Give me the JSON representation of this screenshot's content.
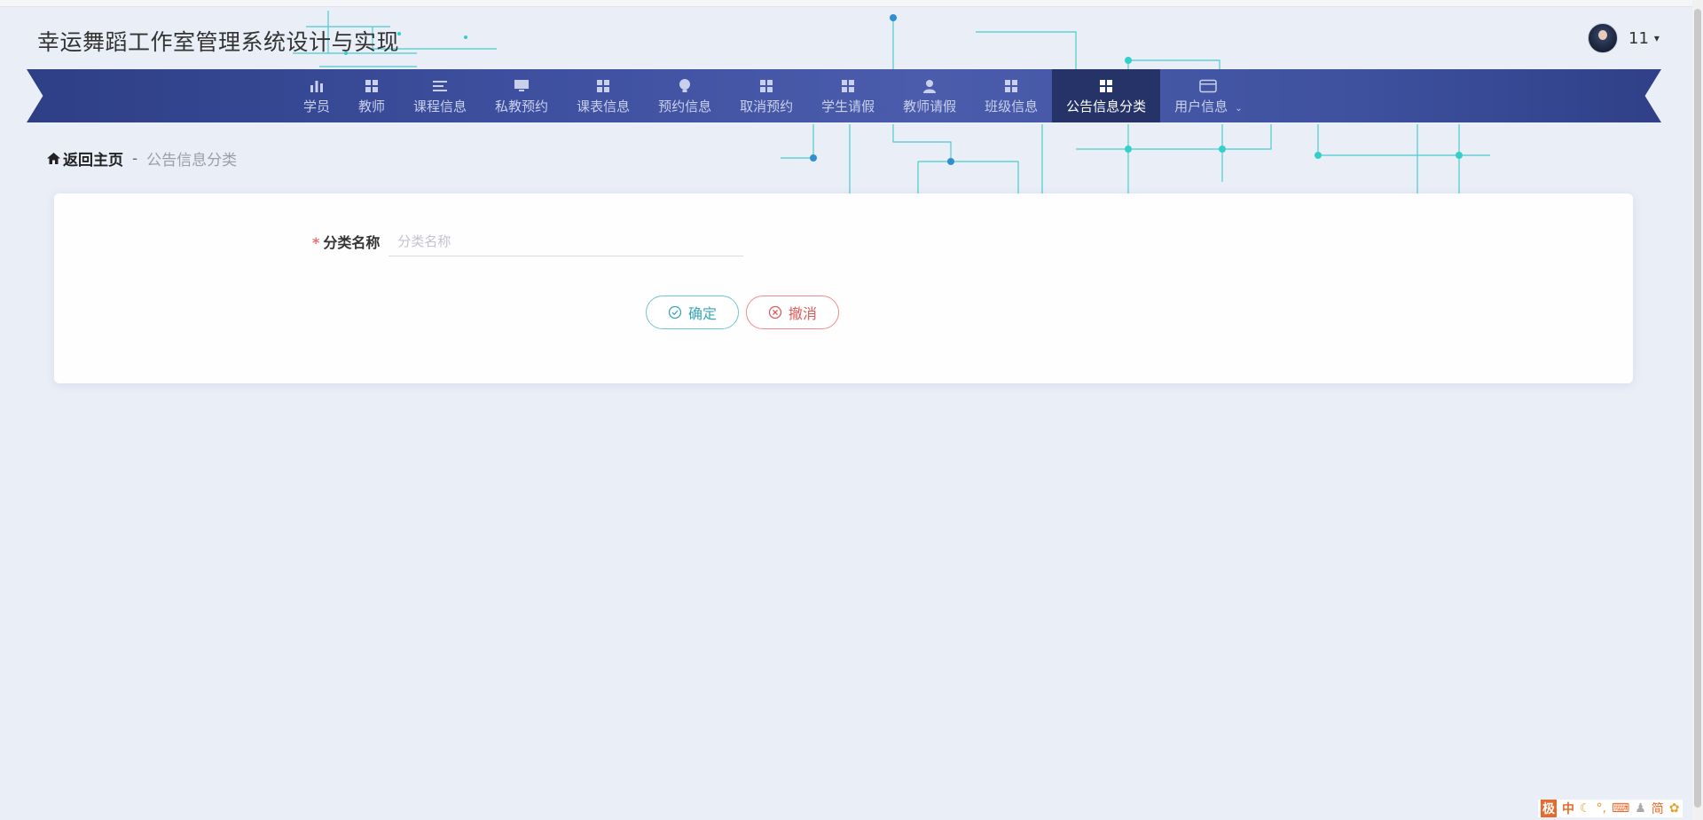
{
  "app": {
    "title": "幸运舞蹈工作室管理系统设计与实现"
  },
  "user": {
    "name": "11",
    "caret": "▾",
    "avatar_icon": "user-avatar"
  },
  "nav": {
    "items": [
      {
        "label": "学员",
        "icon": "bar-chart-icon"
      },
      {
        "label": "教师",
        "icon": "grid-icon"
      },
      {
        "label": "课程信息",
        "icon": "list-icon"
      },
      {
        "label": "私教预约",
        "icon": "monitor-icon"
      },
      {
        "label": "课表信息",
        "icon": "grid-icon"
      },
      {
        "label": "预约信息",
        "icon": "bulb-icon"
      },
      {
        "label": "取消预约",
        "icon": "grid-icon"
      },
      {
        "label": "学生请假",
        "icon": "grid-icon"
      },
      {
        "label": "教师请假",
        "icon": "person-icon"
      },
      {
        "label": "班级信息",
        "icon": "grid-icon"
      },
      {
        "label": "公告信息分类",
        "icon": "grid-icon",
        "active": true
      },
      {
        "label": "用户信息",
        "icon": "card-icon",
        "dropdown": true
      }
    ],
    "dropdown_caret": "⌄",
    "active_color": "#253369"
  },
  "breadcrumb": {
    "home": "返回主页",
    "separator": "-",
    "current": "公告信息分类"
  },
  "form": {
    "required_mark": "*",
    "field_label": "分类名称",
    "field_placeholder": "分类名称",
    "field_value": ""
  },
  "buttons": {
    "ok": "确定",
    "cancel": "撤消"
  },
  "ime": {
    "logo": "极",
    "mode": "中",
    "simplified": "简"
  },
  "colors": {
    "accent": "#3aa6b7",
    "danger": "#e05a5a",
    "nav_bg": "#3d4f9e"
  }
}
